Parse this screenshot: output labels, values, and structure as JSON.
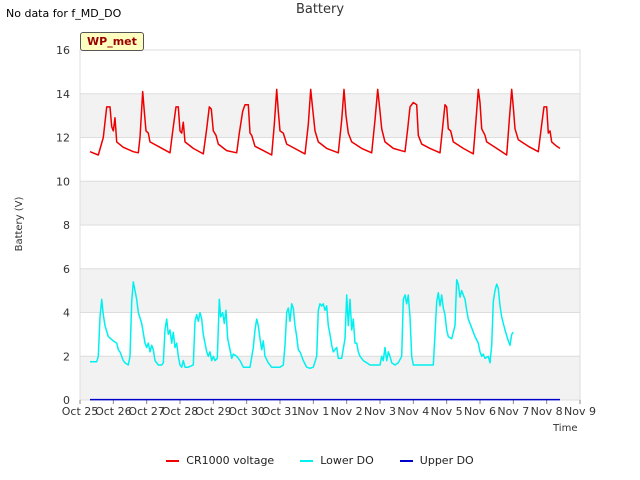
{
  "header": {
    "note": "No data for f_MD_DO",
    "title": "Battery",
    "badge": "WP_met"
  },
  "chart_data": {
    "type": "line",
    "title": "Battery",
    "xlabel": "Time",
    "ylabel": "Battery (V)",
    "x_tick_labels": [
      "Oct 25",
      "Oct 26",
      "Oct 27",
      "Oct 28",
      "Oct 29",
      "Oct 30",
      "Oct 31",
      "Nov 1",
      "Nov 2",
      "Nov 3",
      "Nov 4",
      "Nov 5",
      "Nov 6",
      "Nov 7",
      "Nov 8",
      "Nov 9"
    ],
    "y_ticks": [
      0,
      2,
      4,
      6,
      8,
      10,
      12,
      14,
      16
    ],
    "xlim": [
      0,
      15
    ],
    "ylim": [
      0,
      16
    ],
    "grid": "horizontal bands",
    "legend_position": "bottom",
    "series": [
      {
        "name": "CR1000 voltage",
        "color": "#ee0000",
        "points": [
          [
            0.3,
            11.35
          ],
          [
            0.55,
            11.2
          ],
          [
            0.7,
            12.0
          ],
          [
            0.8,
            13.4
          ],
          [
            0.9,
            13.4
          ],
          [
            0.95,
            12.5
          ],
          [
            1.0,
            12.3
          ],
          [
            1.05,
            12.9
          ],
          [
            1.1,
            11.8
          ],
          [
            1.3,
            11.55
          ],
          [
            1.6,
            11.35
          ],
          [
            1.75,
            11.3
          ],
          [
            1.8,
            12.0
          ],
          [
            1.88,
            14.1
          ],
          [
            1.93,
            13.2
          ],
          [
            1.98,
            12.3
          ],
          [
            2.05,
            12.2
          ],
          [
            2.1,
            11.8
          ],
          [
            2.4,
            11.55
          ],
          [
            2.7,
            11.3
          ],
          [
            2.8,
            12.5
          ],
          [
            2.88,
            13.4
          ],
          [
            2.95,
            13.4
          ],
          [
            3.0,
            12.3
          ],
          [
            3.05,
            12.2
          ],
          [
            3.1,
            12.7
          ],
          [
            3.15,
            11.8
          ],
          [
            3.4,
            11.5
          ],
          [
            3.7,
            11.25
          ],
          [
            3.8,
            12.4
          ],
          [
            3.88,
            13.4
          ],
          [
            3.94,
            13.3
          ],
          [
            4.0,
            12.3
          ],
          [
            4.08,
            12.1
          ],
          [
            4.15,
            11.7
          ],
          [
            4.4,
            11.4
          ],
          [
            4.7,
            11.3
          ],
          [
            4.78,
            12.2
          ],
          [
            4.88,
            13.2
          ],
          [
            4.95,
            13.5
          ],
          [
            5.05,
            13.5
          ],
          [
            5.1,
            12.2
          ],
          [
            5.15,
            12.1
          ],
          [
            5.25,
            11.6
          ],
          [
            5.5,
            11.4
          ],
          [
            5.75,
            11.2
          ],
          [
            5.83,
            12.6
          ],
          [
            5.9,
            14.2
          ],
          [
            5.95,
            13.2
          ],
          [
            6.0,
            12.3
          ],
          [
            6.1,
            12.2
          ],
          [
            6.2,
            11.7
          ],
          [
            6.5,
            11.45
          ],
          [
            6.75,
            11.25
          ],
          [
            6.85,
            12.6
          ],
          [
            6.92,
            14.2
          ],
          [
            6.98,
            13.3
          ],
          [
            7.05,
            12.3
          ],
          [
            7.15,
            11.8
          ],
          [
            7.4,
            11.5
          ],
          [
            7.75,
            11.3
          ],
          [
            7.85,
            12.8
          ],
          [
            7.92,
            14.2
          ],
          [
            7.98,
            13.0
          ],
          [
            8.05,
            12.2
          ],
          [
            8.15,
            11.8
          ],
          [
            8.45,
            11.5
          ],
          [
            8.75,
            11.3
          ],
          [
            8.85,
            12.8
          ],
          [
            8.93,
            14.2
          ],
          [
            9.0,
            13.2
          ],
          [
            9.05,
            12.4
          ],
          [
            9.15,
            11.8
          ],
          [
            9.4,
            11.5
          ],
          [
            9.75,
            11.35
          ],
          [
            9.83,
            12.4
          ],
          [
            9.9,
            13.4
          ],
          [
            10.0,
            13.6
          ],
          [
            10.1,
            13.5
          ],
          [
            10.15,
            12.1
          ],
          [
            10.25,
            11.7
          ],
          [
            10.5,
            11.5
          ],
          [
            10.8,
            11.3
          ],
          [
            10.88,
            12.5
          ],
          [
            10.95,
            13.5
          ],
          [
            11.0,
            13.4
          ],
          [
            11.05,
            12.4
          ],
          [
            11.12,
            12.3
          ],
          [
            11.2,
            11.8
          ],
          [
            11.5,
            11.5
          ],
          [
            11.8,
            11.25
          ],
          [
            11.88,
            12.8
          ],
          [
            11.95,
            14.2
          ],
          [
            12.0,
            13.6
          ],
          [
            12.05,
            12.4
          ],
          [
            12.15,
            12.1
          ],
          [
            12.2,
            11.8
          ],
          [
            12.5,
            11.5
          ],
          [
            12.8,
            11.2
          ],
          [
            12.88,
            12.8
          ],
          [
            12.95,
            14.2
          ],
          [
            13.0,
            13.4
          ],
          [
            13.05,
            12.4
          ],
          [
            13.15,
            11.9
          ],
          [
            13.45,
            11.6
          ],
          [
            13.75,
            11.35
          ],
          [
            13.85,
            12.6
          ],
          [
            13.92,
            13.4
          ],
          [
            14.0,
            13.4
          ],
          [
            14.05,
            12.2
          ],
          [
            14.1,
            12.3
          ],
          [
            14.15,
            11.8
          ],
          [
            14.3,
            11.6
          ],
          [
            14.4,
            11.5
          ]
        ]
      },
      {
        "name": "Lower DO",
        "color": "#00f0f0",
        "points": [
          [
            0.3,
            1.75
          ],
          [
            0.5,
            1.75
          ],
          [
            0.55,
            2.0
          ],
          [
            0.6,
            3.8
          ],
          [
            0.65,
            4.6
          ],
          [
            0.7,
            3.9
          ],
          [
            0.75,
            3.4
          ],
          [
            0.85,
            2.9
          ],
          [
            1.0,
            2.7
          ],
          [
            1.1,
            2.6
          ],
          [
            1.15,
            2.3
          ],
          [
            1.2,
            2.2
          ],
          [
            1.3,
            1.8
          ],
          [
            1.35,
            1.7
          ],
          [
            1.45,
            1.6
          ],
          [
            1.5,
            2.0
          ],
          [
            1.55,
            4.5
          ],
          [
            1.6,
            5.4
          ],
          [
            1.65,
            5.0
          ],
          [
            1.7,
            4.6
          ],
          [
            1.75,
            4.0
          ],
          [
            1.85,
            3.5
          ],
          [
            1.95,
            2.6
          ],
          [
            2.0,
            2.4
          ],
          [
            2.05,
            2.6
          ],
          [
            2.1,
            2.2
          ],
          [
            2.15,
            2.5
          ],
          [
            2.2,
            2.3
          ],
          [
            2.25,
            1.8
          ],
          [
            2.35,
            1.6
          ],
          [
            2.45,
            1.6
          ],
          [
            2.5,
            1.7
          ],
          [
            2.55,
            3.2
          ],
          [
            2.6,
            3.7
          ],
          [
            2.65,
            3.0
          ],
          [
            2.7,
            3.2
          ],
          [
            2.75,
            2.6
          ],
          [
            2.8,
            3.1
          ],
          [
            2.85,
            2.4
          ],
          [
            2.9,
            2.6
          ],
          [
            2.95,
            2.0
          ],
          [
            3.0,
            1.6
          ],
          [
            3.05,
            1.5
          ],
          [
            3.1,
            1.8
          ],
          [
            3.15,
            1.5
          ],
          [
            3.25,
            1.5
          ],
          [
            3.4,
            1.6
          ],
          [
            3.45,
            3.6
          ],
          [
            3.5,
            3.9
          ],
          [
            3.55,
            3.6
          ],
          [
            3.6,
            4.0
          ],
          [
            3.65,
            3.7
          ],
          [
            3.7,
            3.0
          ],
          [
            3.75,
            2.6
          ],
          [
            3.8,
            2.2
          ],
          [
            3.85,
            2.0
          ],
          [
            3.9,
            2.2
          ],
          [
            3.95,
            1.8
          ],
          [
            4.0,
            2.0
          ],
          [
            4.05,
            1.8
          ],
          [
            4.12,
            1.9
          ],
          [
            4.18,
            4.6
          ],
          [
            4.22,
            3.8
          ],
          [
            4.28,
            4.0
          ],
          [
            4.33,
            3.5
          ],
          [
            4.38,
            4.1
          ],
          [
            4.43,
            2.8
          ],
          [
            4.5,
            2.3
          ],
          [
            4.55,
            1.9
          ],
          [
            4.6,
            2.1
          ],
          [
            4.7,
            2.0
          ],
          [
            4.8,
            1.8
          ],
          [
            4.9,
            1.5
          ],
          [
            5.0,
            1.5
          ],
          [
            5.1,
            1.5
          ],
          [
            5.2,
            2.4
          ],
          [
            5.25,
            3.2
          ],
          [
            5.3,
            3.7
          ],
          [
            5.35,
            3.4
          ],
          [
            5.4,
            2.8
          ],
          [
            5.45,
            2.3
          ],
          [
            5.5,
            2.7
          ],
          [
            5.55,
            2.0
          ],
          [
            5.65,
            1.7
          ],
          [
            5.75,
            1.5
          ],
          [
            5.85,
            1.5
          ],
          [
            6.0,
            1.5
          ],
          [
            6.1,
            1.6
          ],
          [
            6.15,
            2.5
          ],
          [
            6.2,
            4.0
          ],
          [
            6.25,
            4.2
          ],
          [
            6.3,
            3.6
          ],
          [
            6.35,
            4.4
          ],
          [
            6.4,
            4.2
          ],
          [
            6.45,
            3.4
          ],
          [
            6.5,
            2.9
          ],
          [
            6.55,
            2.3
          ],
          [
            6.6,
            2.2
          ],
          [
            6.7,
            1.8
          ],
          [
            6.8,
            1.5
          ],
          [
            6.9,
            1.45
          ],
          [
            7.0,
            1.5
          ],
          [
            7.1,
            2.0
          ],
          [
            7.15,
            4.1
          ],
          [
            7.2,
            4.4
          ],
          [
            7.25,
            4.3
          ],
          [
            7.3,
            4.4
          ],
          [
            7.35,
            4.1
          ],
          [
            7.4,
            4.3
          ],
          [
            7.45,
            3.4
          ],
          [
            7.5,
            3.0
          ],
          [
            7.55,
            2.5
          ],
          [
            7.6,
            2.2
          ],
          [
            7.7,
            2.4
          ],
          [
            7.75,
            1.9
          ],
          [
            7.85,
            1.9
          ],
          [
            7.95,
            2.8
          ],
          [
            8.0,
            4.8
          ],
          [
            8.05,
            3.4
          ],
          [
            8.1,
            4.6
          ],
          [
            8.15,
            3.2
          ],
          [
            8.2,
            3.7
          ],
          [
            8.25,
            2.6
          ],
          [
            8.3,
            2.6
          ],
          [
            8.35,
            2.2
          ],
          [
            8.4,
            2.0
          ],
          [
            8.5,
            1.8
          ],
          [
            8.6,
            1.7
          ],
          [
            8.7,
            1.6
          ],
          [
            8.8,
            1.6
          ],
          [
            8.9,
            1.6
          ],
          [
            9.0,
            1.6
          ],
          [
            9.05,
            2.0
          ],
          [
            9.1,
            1.8
          ],
          [
            9.15,
            2.4
          ],
          [
            9.2,
            1.8
          ],
          [
            9.25,
            2.2
          ],
          [
            9.3,
            2.0
          ],
          [
            9.35,
            1.7
          ],
          [
            9.45,
            1.6
          ],
          [
            9.55,
            1.7
          ],
          [
            9.65,
            2.0
          ],
          [
            9.7,
            4.6
          ],
          [
            9.75,
            4.8
          ],
          [
            9.8,
            4.4
          ],
          [
            9.85,
            4.8
          ],
          [
            9.9,
            3.8
          ],
          [
            9.95,
            2.0
          ],
          [
            10.0,
            1.6
          ],
          [
            10.1,
            1.6
          ],
          [
            10.3,
            1.6
          ],
          [
            10.5,
            1.6
          ],
          [
            10.6,
            1.6
          ],
          [
            10.65,
            3.0
          ],
          [
            10.7,
            4.5
          ],
          [
            10.75,
            4.9
          ],
          [
            10.8,
            4.3
          ],
          [
            10.85,
            4.8
          ],
          [
            10.9,
            4.2
          ],
          [
            10.95,
            3.9
          ],
          [
            11.0,
            3.2
          ],
          [
            11.05,
            2.9
          ],
          [
            11.15,
            2.8
          ],
          [
            11.25,
            3.4
          ],
          [
            11.3,
            5.5
          ],
          [
            11.35,
            5.3
          ],
          [
            11.4,
            4.7
          ],
          [
            11.45,
            5.0
          ],
          [
            11.5,
            4.8
          ],
          [
            11.55,
            4.6
          ],
          [
            11.6,
            4.1
          ],
          [
            11.65,
            3.7
          ],
          [
            11.75,
            3.3
          ],
          [
            11.85,
            2.9
          ],
          [
            11.95,
            2.6
          ],
          [
            12.0,
            2.2
          ],
          [
            12.05,
            2.0
          ],
          [
            12.1,
            2.1
          ],
          [
            12.15,
            1.9
          ],
          [
            12.25,
            2.0
          ],
          [
            12.3,
            1.7
          ],
          [
            12.35,
            2.5
          ],
          [
            12.4,
            4.5
          ],
          [
            12.45,
            5.0
          ],
          [
            12.5,
            5.3
          ],
          [
            12.55,
            5.1
          ],
          [
            12.6,
            4.3
          ],
          [
            12.65,
            3.8
          ],
          [
            12.75,
            3.2
          ],
          [
            12.85,
            2.7
          ],
          [
            12.9,
            2.5
          ],
          [
            12.95,
            3.0
          ],
          [
            13.0,
            3.1
          ]
        ]
      },
      {
        "name": "Upper DO",
        "color": "#0000cc",
        "points": [
          [
            0.3,
            0.02
          ],
          [
            14.4,
            0.02
          ]
        ]
      }
    ]
  }
}
